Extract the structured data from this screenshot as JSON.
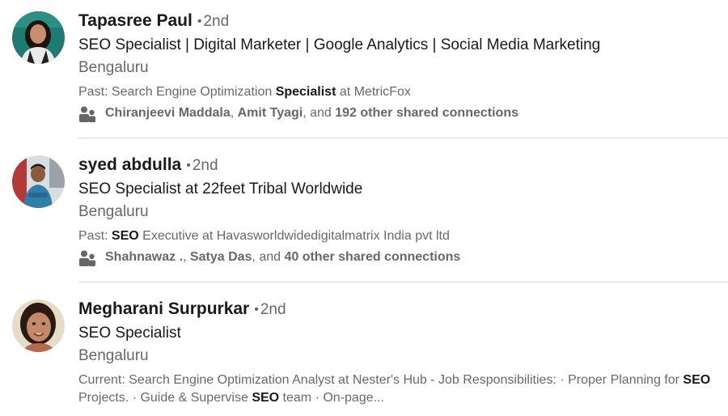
{
  "results": [
    {
      "name": "Tapasree Paul",
      "degree": "2nd",
      "headline": "SEO Specialist | Digital Marketer | Google Analytics | Social Media Marketing",
      "location": "Bengaluru",
      "summary": {
        "prefix": "Past: Search Engine Optimization ",
        "highlight": "Specialist",
        "suffix": " at MetricFox"
      },
      "connections": {
        "person1": "Chiranjeevi Maddala",
        "sep": ", ",
        "person2": "Amit Tyagi",
        "and": ", and ",
        "others": "192 other shared connections"
      }
    },
    {
      "name": "syed abdulla",
      "degree": "2nd",
      "headline": "SEO Specialist at 22feet Tribal Worldwide",
      "location": "Bengaluru",
      "summary": {
        "prefix": "Past: ",
        "highlight": "SEO",
        "suffix": " Executive at Havasworldwidedigitalmatrix India pvt ltd"
      },
      "connections": {
        "person1": "Shahnawaz .",
        "sep": ", ",
        "person2": "Satya Das",
        "and": ", and ",
        "others": "40 other shared connections"
      }
    },
    {
      "name": "Megharani Surpurkar",
      "degree": "2nd",
      "headline": "SEO Specialist",
      "location": "Bengaluru",
      "summary": {
        "part1": "Current: Search Engine Optimization Analyst at Nester's Hub - Job Responsibilities: · Proper Planning for ",
        "highlight1": "SEO",
        "part2": " Projects. · Guide & Supervise ",
        "highlight2": "SEO",
        "part3": " team · On-page..."
      }
    }
  ],
  "separator": "•",
  "colors": {
    "text_primary": "#1a1a1a",
    "text_secondary": "#666666",
    "divider": "#d9d9d9"
  }
}
